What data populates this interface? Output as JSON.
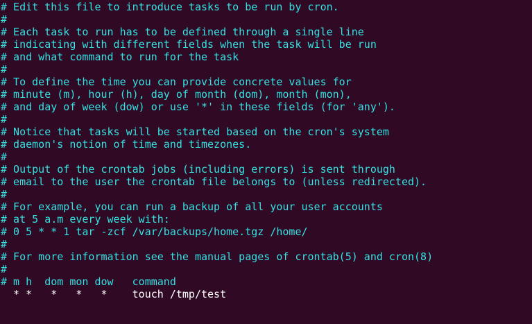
{
  "terminal": {
    "colors": {
      "background": "#300a24",
      "comment": "#34e2e2",
      "text": "#ffffff"
    },
    "lines": [
      {
        "text": "# Edit this file to introduce tasks to be run by cron.",
        "kind": "comment"
      },
      {
        "text": "#",
        "kind": "comment"
      },
      {
        "text": "# Each task to run has to be defined through a single line",
        "kind": "comment"
      },
      {
        "text": "# indicating with different fields when the task will be run",
        "kind": "comment"
      },
      {
        "text": "# and what command to run for the task",
        "kind": "comment"
      },
      {
        "text": "#",
        "kind": "comment"
      },
      {
        "text": "# To define the time you can provide concrete values for",
        "kind": "comment"
      },
      {
        "text": "# minute (m), hour (h), day of month (dom), month (mon),",
        "kind": "comment"
      },
      {
        "text": "# and day of week (dow) or use '*' in these fields (for 'any').",
        "kind": "comment"
      },
      {
        "text": "#",
        "kind": "comment"
      },
      {
        "text": "# Notice that tasks will be started based on the cron's system",
        "kind": "comment"
      },
      {
        "text": "# daemon's notion of time and timezones.",
        "kind": "comment"
      },
      {
        "text": "#",
        "kind": "comment"
      },
      {
        "text": "# Output of the crontab jobs (including errors) is sent through",
        "kind": "comment"
      },
      {
        "text": "# email to the user the crontab file belongs to (unless redirected).",
        "kind": "comment"
      },
      {
        "text": "#",
        "kind": "comment"
      },
      {
        "text": "# For example, you can run a backup of all your user accounts",
        "kind": "comment"
      },
      {
        "text": "# at 5 a.m every week with:",
        "kind": "comment"
      },
      {
        "text": "# 0 5 * * 1 tar -zcf /var/backups/home.tgz /home/",
        "kind": "comment"
      },
      {
        "text": "#",
        "kind": "comment"
      },
      {
        "text": "# For more information see the manual pages of crontab(5) and cron(8)",
        "kind": "comment"
      },
      {
        "text": "#",
        "kind": "comment"
      },
      {
        "text": "# m h  dom mon dow   command",
        "kind": "comment"
      },
      {
        "text": "  * *   *   *   *    touch /tmp/test",
        "kind": "entry"
      }
    ]
  }
}
